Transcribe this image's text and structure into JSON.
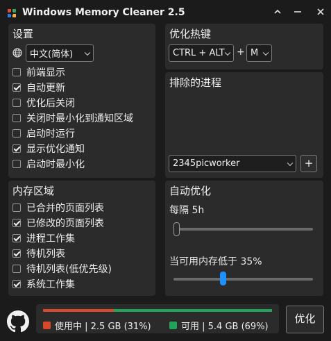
{
  "window": {
    "title": "Windows Memory Cleaner 2.5"
  },
  "settings": {
    "title": "设置",
    "language": "中文(简体)",
    "options": [
      {
        "label": "前端显示",
        "checked": false
      },
      {
        "label": "自动更新",
        "checked": true
      },
      {
        "label": "优化后关闭",
        "checked": false
      },
      {
        "label": "关闭时最小化到通知区域",
        "checked": false
      },
      {
        "label": "启动时运行",
        "checked": false
      },
      {
        "label": "显示优化通知",
        "checked": true
      },
      {
        "label": "启动时最小化",
        "checked": false
      }
    ]
  },
  "hotkey": {
    "title": "优化热键",
    "modifier": "CTRL + ALT",
    "plus": "+",
    "key": "M"
  },
  "excluded": {
    "title": "排除的进程",
    "process": "2345picworker",
    "add_label": "+"
  },
  "memory_areas": {
    "title": "内存区域",
    "options": [
      {
        "label": "已合并的页面列表",
        "checked": false
      },
      {
        "label": "已修改的页面列表",
        "checked": true
      },
      {
        "label": "进程工作集",
        "checked": true
      },
      {
        "label": "待机列表",
        "checked": true
      },
      {
        "label": "待机列表(低优先级)",
        "checked": false
      },
      {
        "label": "系统工作集",
        "checked": true
      }
    ]
  },
  "auto_optimize": {
    "title": "自动优化",
    "interval_label": "每隔 5h",
    "interval_value": 0.0,
    "threshold_label": "当可用内存低于 35%",
    "threshold_value": 0.35
  },
  "memory": {
    "used_label": "使用中 | 2.5 GB (31%)",
    "free_label": "可用 | 5.4 GB (69%)",
    "used_fraction": 0.31,
    "used_color": "#d9482b",
    "free_color": "#21a35a"
  },
  "optimize_button": "优化",
  "colors": {
    "accent": "#1e90ff"
  },
  "icons": {
    "app": "app-icon",
    "github": "github-icon",
    "language": "globe-icon"
  }
}
